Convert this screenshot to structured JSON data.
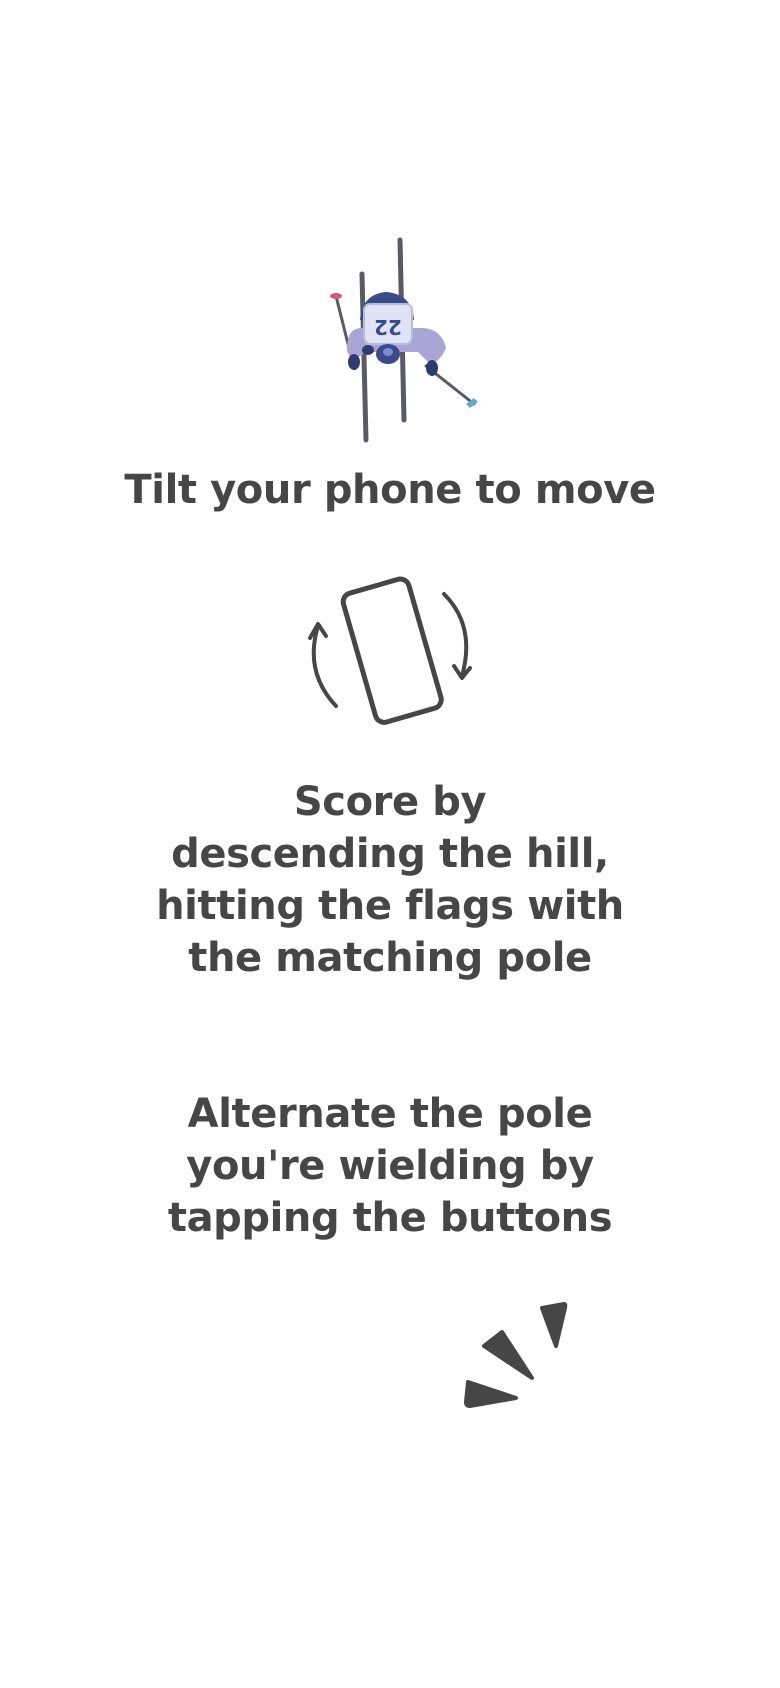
{
  "skier": {
    "bib_number": "22",
    "icon": "skier-icon",
    "colors": {
      "suit": "#a9a6d6",
      "helmet": "#3b4a8a",
      "poles": "#5a5a66",
      "left_basket": "#d25a76",
      "right_basket": "#6aa6cc"
    }
  },
  "instructions": {
    "tilt": "Tilt your phone to move",
    "score": "Score by\ndescending the hill,\nhitting the flags with\nthe matching pole",
    "alternate": "Alternate the pole\nyou're wielding by\ntapping the buttons"
  },
  "icons": {
    "tilt": "tilt-phone-icon",
    "tap": "tap-icon"
  },
  "colors": {
    "text": "#464646",
    "background": "#ffffff"
  }
}
